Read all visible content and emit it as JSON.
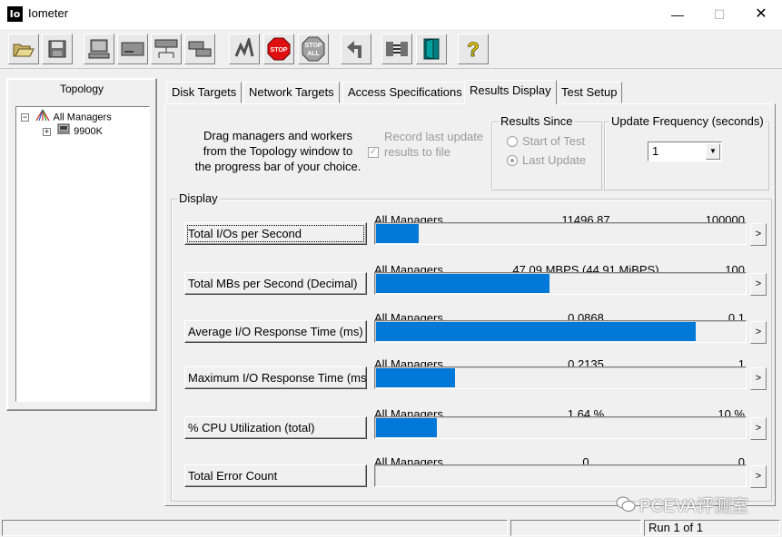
{
  "window": {
    "title": "Iometer",
    "app_icon_text": "Io",
    "min_glyph": "—",
    "max_glyph": "☐",
    "close_glyph": "✕"
  },
  "toolbar": {
    "buttons": [
      {
        "icon": "open-folder-icon"
      },
      {
        "icon": "save-disk-icon"
      },
      {
        "icon": "start-display-manager-icon"
      },
      {
        "icon": "new-disk-worker-icon"
      },
      {
        "icon": "new-network-worker-icon"
      },
      {
        "icon": "duplicate-worker-icon"
      },
      {
        "icon": "start-tests-icon"
      },
      {
        "icon": "stop-icon",
        "text": "STOP"
      },
      {
        "icon": "stop-all-icon",
        "text": "STOP ALL"
      },
      {
        "icon": "reset-workers-icon"
      },
      {
        "icon": "workers-icon"
      },
      {
        "icon": "exit-icon"
      },
      {
        "icon": "help-icon",
        "text": "?"
      }
    ]
  },
  "topology": {
    "label": "Topology",
    "root": {
      "label": "All Managers",
      "expander": "−"
    },
    "children": [
      {
        "label": "9900K",
        "expander": "+"
      }
    ]
  },
  "tabs": [
    {
      "label": "Disk Targets",
      "active": false
    },
    {
      "label": "Network Targets",
      "active": false
    },
    {
      "label": "Access Specifications",
      "active": false
    },
    {
      "label": "Results Display",
      "active": true
    },
    {
      "label": "Test Setup",
      "active": false
    }
  ],
  "results": {
    "drag_hint": "Drag managers and workers from the Topology window to the progress bar of your choice.",
    "record_last_label": "Record last update results to file",
    "record_last_checked": true,
    "results_since": {
      "title": "Results Since",
      "options": [
        {
          "label": "Start of Test",
          "selected": false
        },
        {
          "label": "Last Update",
          "selected": true
        }
      ]
    },
    "update_frequency": {
      "title": "Update Frequency (seconds)",
      "value": "1",
      "arrow": "▼"
    },
    "display_label": "Display",
    "more_glyph": ">",
    "metrics": [
      {
        "button": "Total I/Os per Second",
        "manager": "All Managers",
        "value": "11496.87",
        "max": "100000",
        "fraction": 0.115,
        "focused": true
      },
      {
        "button": "Total MBs per Second (Decimal)",
        "manager": "All Managers",
        "value": "47.09 MBPS (44.91 MiBPS)",
        "max": "100",
        "fraction": 0.471,
        "focused": false
      },
      {
        "button": "Average I/O Response Time (ms)",
        "manager": "All Managers",
        "value": "0.0868",
        "max": "0.1",
        "fraction": 0.868,
        "focused": false
      },
      {
        "button": "Maximum I/O Response Time (ms)",
        "manager": "All Managers",
        "value": "0.2135",
        "max": "1",
        "fraction": 0.2135,
        "focused": false
      },
      {
        "button": "% CPU Utilization (total)",
        "manager": "All Managers",
        "value": "1.64 %",
        "max": "10 %",
        "fraction": 0.164,
        "focused": false
      },
      {
        "button": "Total Error Count",
        "manager": "All Managers",
        "value": "0",
        "max": "0",
        "fraction": 0,
        "focused": false
      }
    ]
  },
  "statusbar": {
    "run": "Run 1 of 1"
  },
  "watermark": "PCEVA评测室",
  "colors": {
    "bar": "#0078d7",
    "stop_red": "#e01010"
  }
}
